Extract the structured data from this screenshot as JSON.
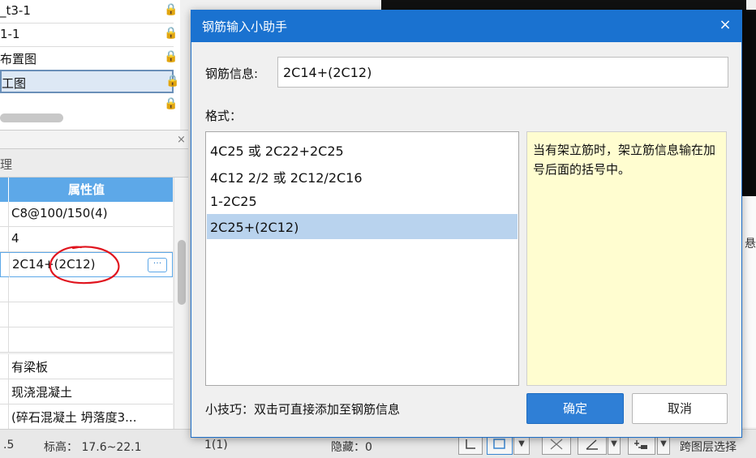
{
  "drawing_list": {
    "items": [
      {
        "label": "_t3-1",
        "selected": false
      },
      {
        "label": "1-1",
        "selected": false
      },
      {
        "label": "布置图",
        "selected": false
      },
      {
        "label": "工图",
        "selected": true
      }
    ],
    "lock_glyph": "🔒"
  },
  "property_panel": {
    "close_glyph": "×",
    "tab_label": "理",
    "header_value": "属性值",
    "rows": [
      {
        "value": "C8@100/150(4)"
      },
      {
        "value": "4"
      },
      {
        "value": "2C14+(2C12)",
        "editing": true
      },
      {
        "value": ""
      },
      {
        "value": ""
      },
      {
        "value": ""
      },
      {
        "value": "有梁板"
      },
      {
        "value": "现浇混凝土"
      },
      {
        "value": "(碎石混凝土 坍落度3..."
      }
    ],
    "ellipsis_glyph": "···",
    "annotation_color": "#e0141e"
  },
  "status_bar": {
    "left_value": ".5",
    "elevation": "标高： 17.6~22.1",
    "count": "1(1)",
    "hidden": "隐藏：0",
    "cross_layer_select": "跨图层选择",
    "right_edge_char": "悬"
  },
  "dialog": {
    "title": "钢筋输入小助手",
    "close_glyph": "×",
    "info_label": "钢筋信息:",
    "info_value": "2C14+(2C12)",
    "format_label": "格式：",
    "formats": [
      "4C25 或 2C22+2C25",
      "4C12 2/2 或 2C12/2C16",
      "1-2C25",
      "2C25+(2C12)"
    ],
    "selected_format_index": 3,
    "hint": "当有架立筋时，架立筋信息输在加号后面的括号中。",
    "tip": "小技巧：双击可直接添加至钢筋信息",
    "ok_label": "确定",
    "cancel_label": "取消",
    "accent": "#1a72d0"
  }
}
